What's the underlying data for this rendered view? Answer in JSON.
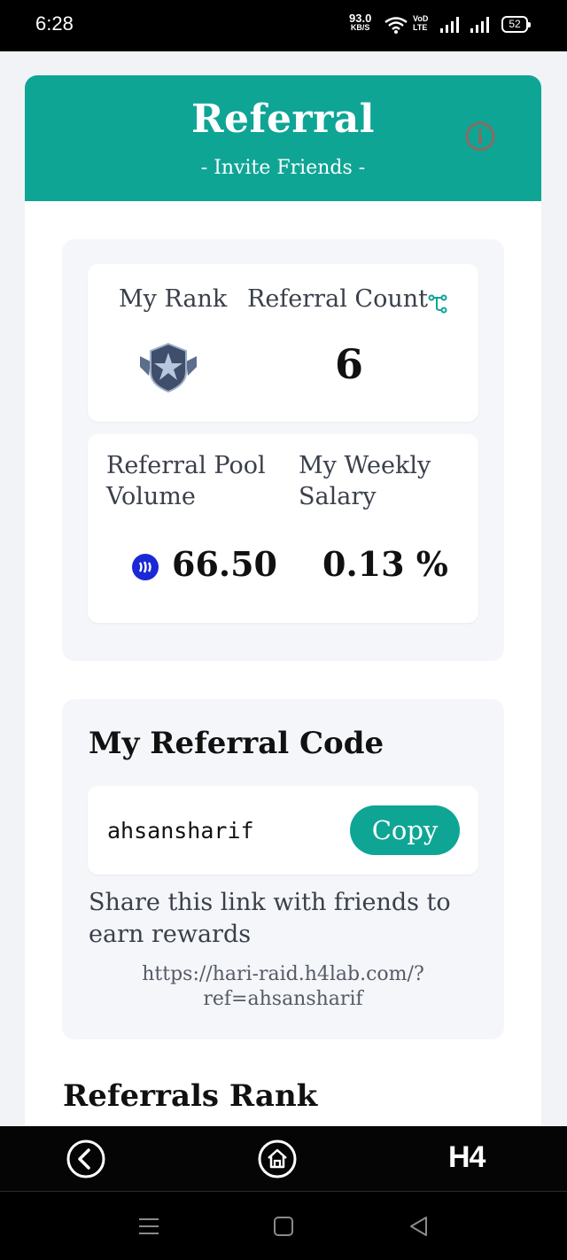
{
  "status": {
    "time": "6:28",
    "net_speed_value": "93.0",
    "net_speed_unit": "KB/S",
    "volte_top": "VoD",
    "volte_bottom": "LTE",
    "battery": "52"
  },
  "header": {
    "title": "Referral",
    "subtitle": "- Invite Friends -"
  },
  "stats": {
    "my_rank_label": "My Rank",
    "referral_count_label": "Referral Count",
    "referral_count_value": "6",
    "pool_label_1": "Referral Pool",
    "pool_label_2": "Volume",
    "salary_label_1": "My Weekly",
    "salary_label_2": "Salary",
    "pool_value": "66.50",
    "salary_value": "0.13 %"
  },
  "referral_code": {
    "title": "My Referral Code",
    "code": "ahsansharif",
    "copy_label": "Copy",
    "share_line_1": "Share this link with friends to",
    "share_line_2": "earn rewards",
    "link_line_1": "https://hari-raid.h4lab.com/?",
    "link_line_2": "ref=ahsansharif"
  },
  "ranks": {
    "title": "Referrals Rank"
  },
  "app_nav": {
    "logo": "H4"
  },
  "colors": {
    "accent": "#0fa595",
    "steem": "#1a28d6"
  },
  "icons": [
    "wifi-icon",
    "signal-icon",
    "battery-icon",
    "info-icon",
    "share-icon",
    "rank-badge-icon",
    "steem-icon",
    "back-icon",
    "home-icon",
    "menu-icon",
    "square-icon",
    "triangle-back-icon"
  ]
}
